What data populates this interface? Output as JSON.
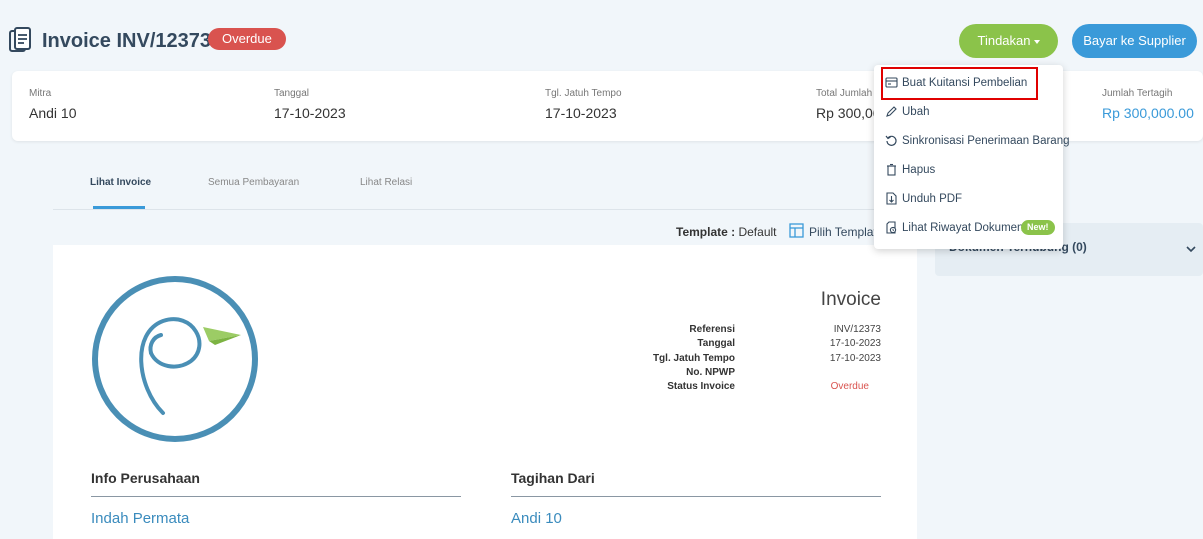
{
  "header": {
    "title": "Invoice INV/12373",
    "status": "Overdue",
    "actions_label": "Tindakan",
    "pay_label": "Bayar ke Supplier"
  },
  "summary": {
    "mitra": {
      "label": "Mitra",
      "value": "Andi 10"
    },
    "tanggal": {
      "label": "Tanggal",
      "value": "17-10-2023"
    },
    "jatuh_tempo": {
      "label": "Tgl. Jatuh Tempo",
      "value": "17-10-2023"
    },
    "total": {
      "label": "Total Jumlah",
      "value": "Rp 300,00"
    },
    "tertagih": {
      "label": "Jumlah Tertagih",
      "value": "Rp 300,000.00"
    }
  },
  "tabs": [
    {
      "label": "Lihat Invoice",
      "active": true
    },
    {
      "label": "Semua Pembayaran",
      "active": false
    },
    {
      "label": "Lihat Relasi",
      "active": false
    }
  ],
  "template": {
    "label": "Template :",
    "value": "Default",
    "pick": "Pilih Templat"
  },
  "invoice": {
    "heading": "Invoice",
    "meta_labels": [
      "Referensi",
      "Tanggal",
      "Tgl. Jatuh Tempo",
      "No. NPWP",
      "Status Invoice"
    ],
    "meta_values": [
      "INV/12373",
      "17-10-2023",
      "17-10-2023",
      "",
      "Overdue"
    ],
    "company_title": "Info Perusahaan",
    "company_name": "Indah Permata",
    "bill_from_title": "Tagihan Dari",
    "bill_from_name": "Andi 10"
  },
  "right_panel": {
    "title": "Dokumen Terhubung (0)"
  },
  "dropdown": {
    "items": [
      {
        "label": "Buat Kuitansi Pembelian",
        "icon": "receipt-icon"
      },
      {
        "label": "Ubah",
        "icon": "pencil-icon"
      },
      {
        "label": "Sinkronisasi Penerimaan Barang",
        "icon": "sync-icon"
      },
      {
        "label": "Hapus",
        "icon": "trash-icon"
      },
      {
        "label": "Unduh PDF",
        "icon": "download-pdf-icon"
      },
      {
        "label": "Lihat Riwayat Dokumen",
        "icon": "history-icon"
      }
    ],
    "new_badge": "New!"
  },
  "colors": {
    "primary": "#3a9ad9",
    "success": "#8bc34a",
    "danger": "#d9534f",
    "highlight": "#e00000"
  }
}
